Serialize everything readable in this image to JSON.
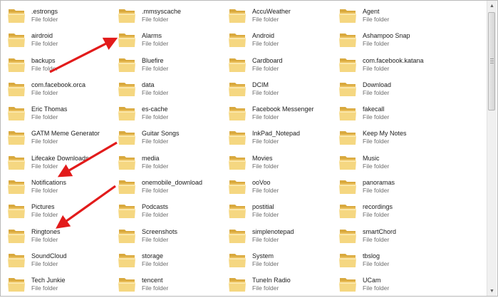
{
  "explorer": {
    "items": [
      {
        "name": ".estrongs",
        "type": "File folder"
      },
      {
        "name": ".mmsyscache",
        "type": "File folder"
      },
      {
        "name": "AccuWeather",
        "type": "File folder"
      },
      {
        "name": "Agent",
        "type": "File folder"
      },
      {
        "name": "airdroid",
        "type": "File folder"
      },
      {
        "name": "Alarms",
        "type": "File folder"
      },
      {
        "name": "Android",
        "type": "File folder"
      },
      {
        "name": "Ashampoo Snap",
        "type": "File folder"
      },
      {
        "name": "backups",
        "type": "File folder"
      },
      {
        "name": "Bluefire",
        "type": "File folder"
      },
      {
        "name": "Cardboard",
        "type": "File folder"
      },
      {
        "name": "com.facebook.katana",
        "type": "File folder"
      },
      {
        "name": "com.facebook.orca",
        "type": "File folder"
      },
      {
        "name": "data",
        "type": "File folder"
      },
      {
        "name": "DCIM",
        "type": "File folder"
      },
      {
        "name": "Download",
        "type": "File folder"
      },
      {
        "name": "Eric Thomas",
        "type": "File folder"
      },
      {
        "name": "es-cache",
        "type": "File folder"
      },
      {
        "name": "Facebook Messenger",
        "type": "File folder"
      },
      {
        "name": "fakecall",
        "type": "File folder"
      },
      {
        "name": "GATM Meme Generator",
        "type": "File folder"
      },
      {
        "name": "Guitar Songs",
        "type": "File folder"
      },
      {
        "name": "InkPad_Notepad",
        "type": "File folder"
      },
      {
        "name": "Keep My Notes",
        "type": "File folder"
      },
      {
        "name": "Lifecake Downloads",
        "type": "File folder"
      },
      {
        "name": "media",
        "type": "File folder"
      },
      {
        "name": "Movies",
        "type": "File folder"
      },
      {
        "name": "Music",
        "type": "File folder"
      },
      {
        "name": "Notifications",
        "type": "File folder"
      },
      {
        "name": "onemobile_download",
        "type": "File folder"
      },
      {
        "name": "ooVoo",
        "type": "File folder"
      },
      {
        "name": "panoramas",
        "type": "File folder"
      },
      {
        "name": "Pictures",
        "type": "File folder"
      },
      {
        "name": "Podcasts",
        "type": "File folder"
      },
      {
        "name": "postitial",
        "type": "File folder"
      },
      {
        "name": "recordings",
        "type": "File folder"
      },
      {
        "name": "Ringtones",
        "type": "File folder"
      },
      {
        "name": "Screenshots",
        "type": "File folder"
      },
      {
        "name": "simplenotepad",
        "type": "File folder"
      },
      {
        "name": "smartChord",
        "type": "File folder"
      },
      {
        "name": "SoundCloud",
        "type": "File folder"
      },
      {
        "name": "storage",
        "type": "File folder"
      },
      {
        "name": "System",
        "type": "File folder"
      },
      {
        "name": "tbslog",
        "type": "File folder"
      },
      {
        "name": "Tech Junkie",
        "type": "File folder"
      },
      {
        "name": "tencent",
        "type": "File folder"
      },
      {
        "name": "TuneIn Radio",
        "type": "File folder"
      },
      {
        "name": "UCam",
        "type": "File folder"
      }
    ]
  },
  "annotations": {
    "arrow_color": "#e21b1b",
    "highlighted_folders": [
      "Alarms",
      "Notifications",
      "Ringtones"
    ]
  },
  "icons": {
    "folder": "folder-icon",
    "scroll_up": "chevron-up-icon",
    "scroll_down": "chevron-down-icon"
  },
  "colors": {
    "folder_body": "#f3d27a",
    "folder_dark": "#d9a93e",
    "text_primary": "#1c1c1c",
    "text_secondary": "#6d6d6d"
  }
}
